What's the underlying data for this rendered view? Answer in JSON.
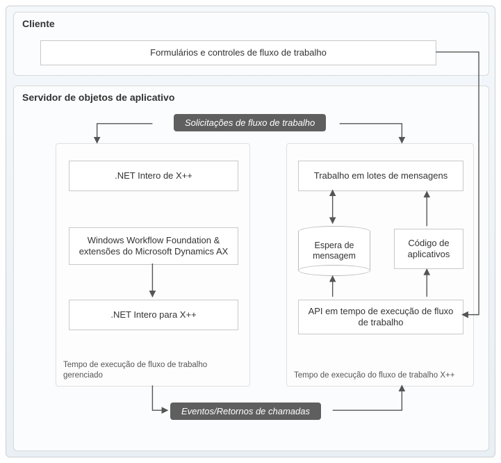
{
  "client": {
    "title": "Cliente",
    "forms_box": "Formulários e controles de fluxo de trabalho"
  },
  "server": {
    "title": "Servidor de objetos de aplicativo",
    "request_label": "Solicitações de fluxo de trabalho",
    "events_label": "Eventos/Retornos de chamadas",
    "managed": {
      "caption": "Tempo de execução de fluxo de trabalho gerenciado",
      "net_from_xpp": ".NET Intero de X++",
      "wwf": "Windows Workflow Foundation & extensões do Microsoft Dynamics AX",
      "net_to_xpp": ".NET Intero para X++"
    },
    "xpp": {
      "caption": "Tempo de execução do fluxo de trabalho X++",
      "batch": "Trabalho em lotes de mensagens",
      "queue": "Espera de mensagem",
      "appcode": "Código de aplicativos",
      "api": "API em tempo de execução de fluxo de trabalho"
    }
  }
}
